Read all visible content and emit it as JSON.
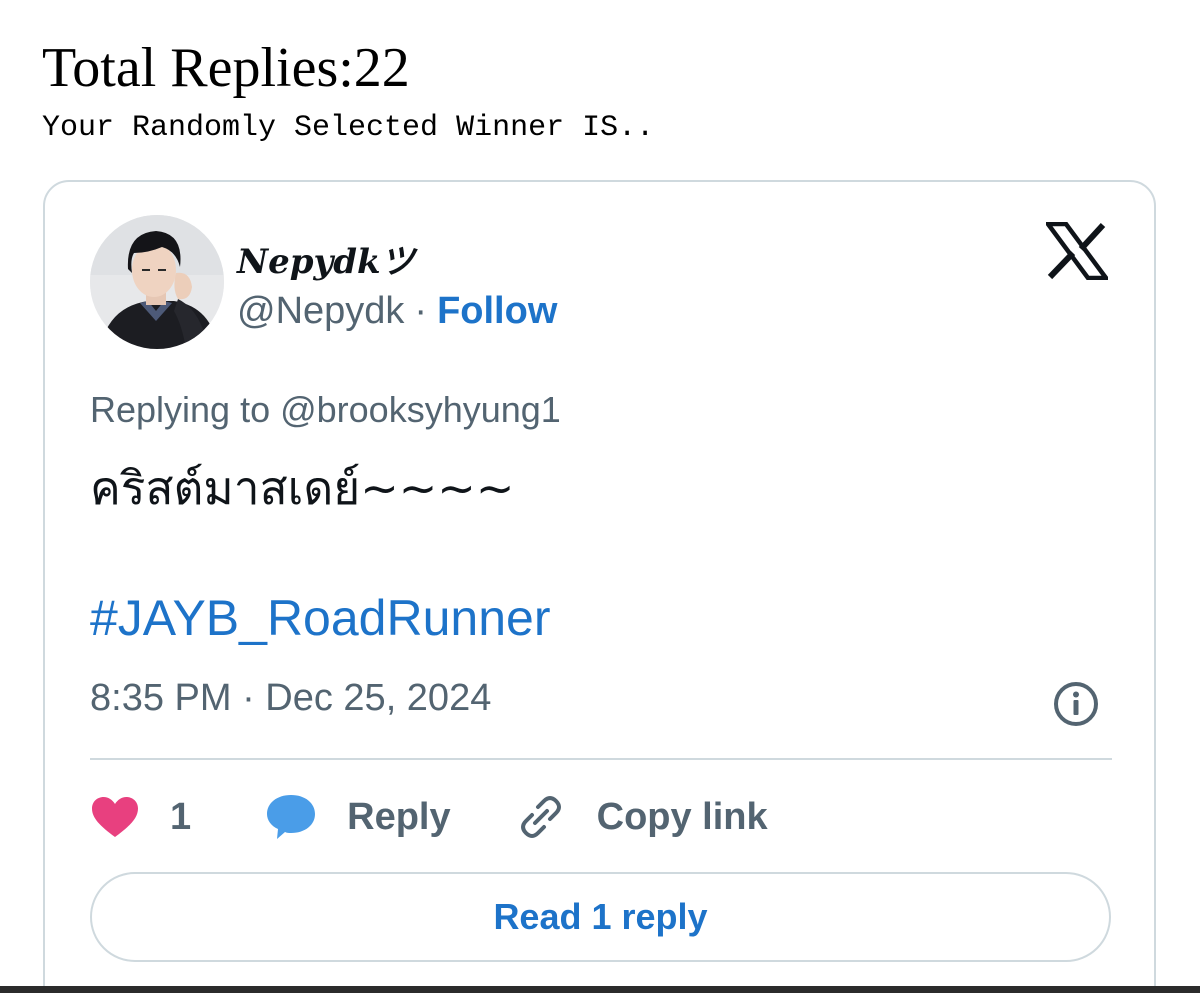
{
  "header": {
    "total_replies": "Total Replies:22",
    "winner_text": "Your Randomly Selected Winner IS.."
  },
  "tweet": {
    "display_name": "Nepydkツ",
    "handle": "@Nepydk",
    "separator": "·",
    "follow_label": "Follow",
    "replying_to": "Replying to @brooksyhyung1",
    "text": "คริสต์มาสเดย์~~~~",
    "hashtag": "#JAYB_RoadRunner",
    "timestamp": "8:35 PM · Dec 25, 2024",
    "like_count": "1",
    "reply_label": "Reply",
    "copy_link_label": "Copy link",
    "read_reply_label": "Read 1 reply"
  },
  "colors": {
    "link_blue": "#1d73c9",
    "muted_gray": "#536471",
    "like_pink": "#e8407f",
    "reply_blue": "#4a9de8",
    "border": "#cfd9de"
  },
  "icons": {
    "brand": "x-logo-icon",
    "info": "info-icon",
    "like": "heart-icon",
    "reply": "speech-bubble-icon",
    "copy": "link-icon"
  }
}
